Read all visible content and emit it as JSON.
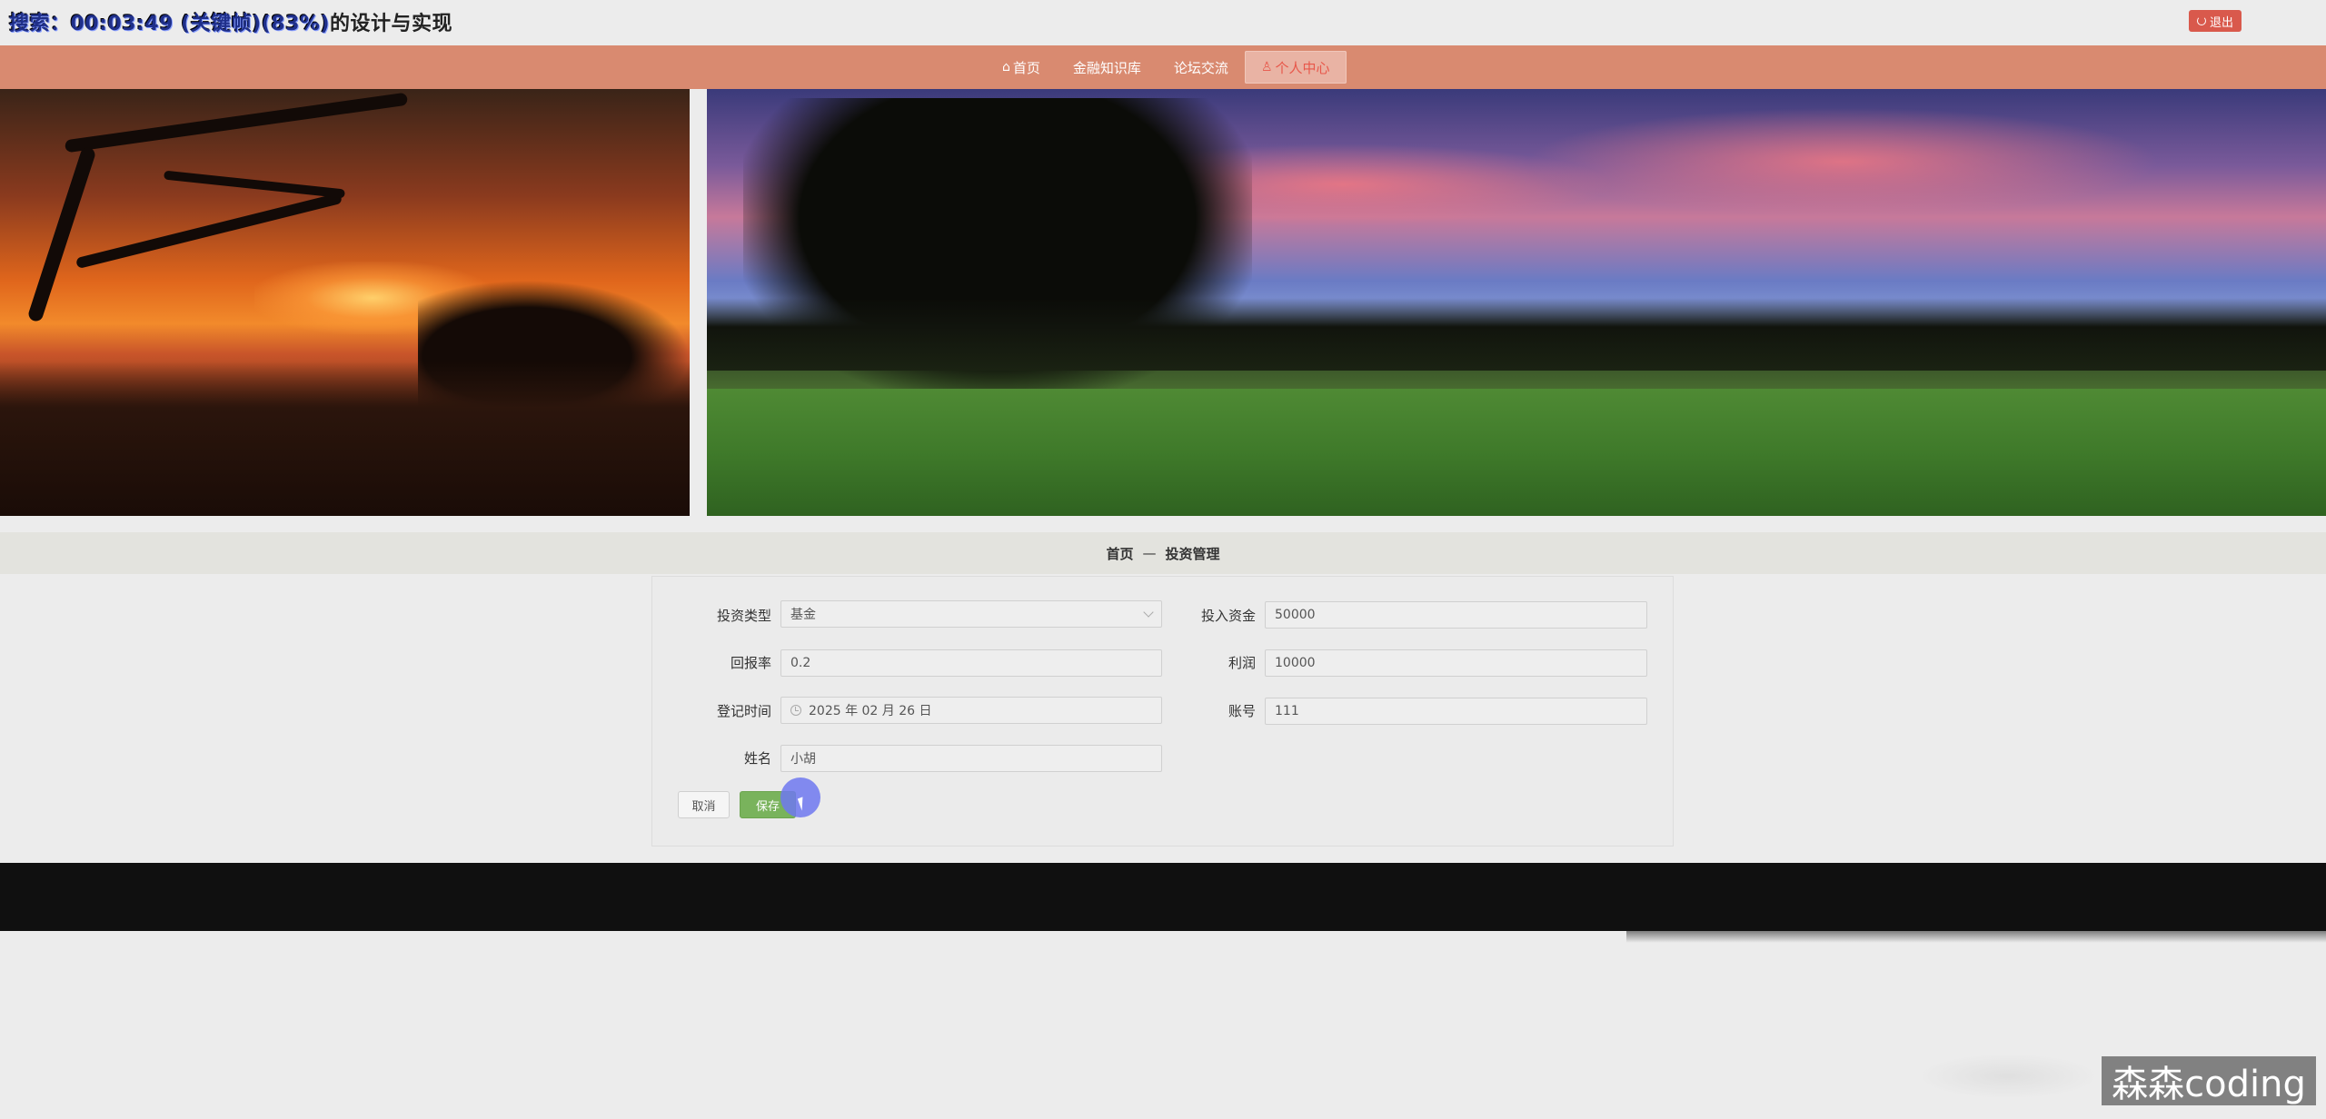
{
  "header": {
    "title_overlay": "搜索：00:03:49 (关键帧)(83%)",
    "title_suffix": "的设计与实现",
    "logout_label": "退出"
  },
  "nav": {
    "items": [
      {
        "icon": "home-icon",
        "glyph": "⌂",
        "label": "首页"
      },
      {
        "icon": "",
        "glyph": "",
        "label": "金融知识库"
      },
      {
        "icon": "",
        "glyph": "",
        "label": "论坛交流"
      },
      {
        "icon": "user-icon",
        "glyph": "♙",
        "label": "个人中心"
      }
    ],
    "active_index": 3
  },
  "breadcrumb": {
    "home": "首页",
    "separator": "—",
    "current": "投资管理"
  },
  "form": {
    "fields": {
      "invest_type": {
        "label": "投资类型",
        "value": "基金"
      },
      "invest_amount": {
        "label": "投入资金",
        "value": "50000"
      },
      "return_rate": {
        "label": "回报率",
        "value": "0.2"
      },
      "profit": {
        "label": "利润",
        "value": "10000"
      },
      "register_time": {
        "label": "登记时间",
        "value": "2025 年 02 月 26 日"
      },
      "account": {
        "label": "账号",
        "value": "111"
      },
      "name": {
        "label": "姓名",
        "value": "小胡"
      }
    },
    "cancel_label": "取消",
    "save_label": "保存"
  },
  "watermark": {
    "text": "森森coding"
  },
  "colors": {
    "nav_bg": "#d98a70",
    "nav_active_text": "#e8574a",
    "logout_bg": "#d9594c",
    "save_bg": "#79b35c",
    "footer_bg": "#101010"
  }
}
